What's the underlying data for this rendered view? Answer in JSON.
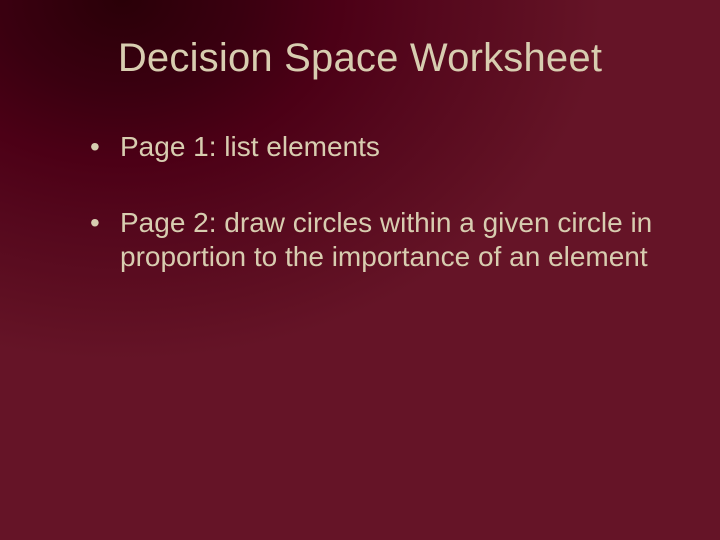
{
  "slide": {
    "title": "Decision Space Worksheet",
    "bullets": [
      "Page 1: list elements",
      "Page 2: draw circles within a given circle in proportion to the importance of an element"
    ]
  }
}
